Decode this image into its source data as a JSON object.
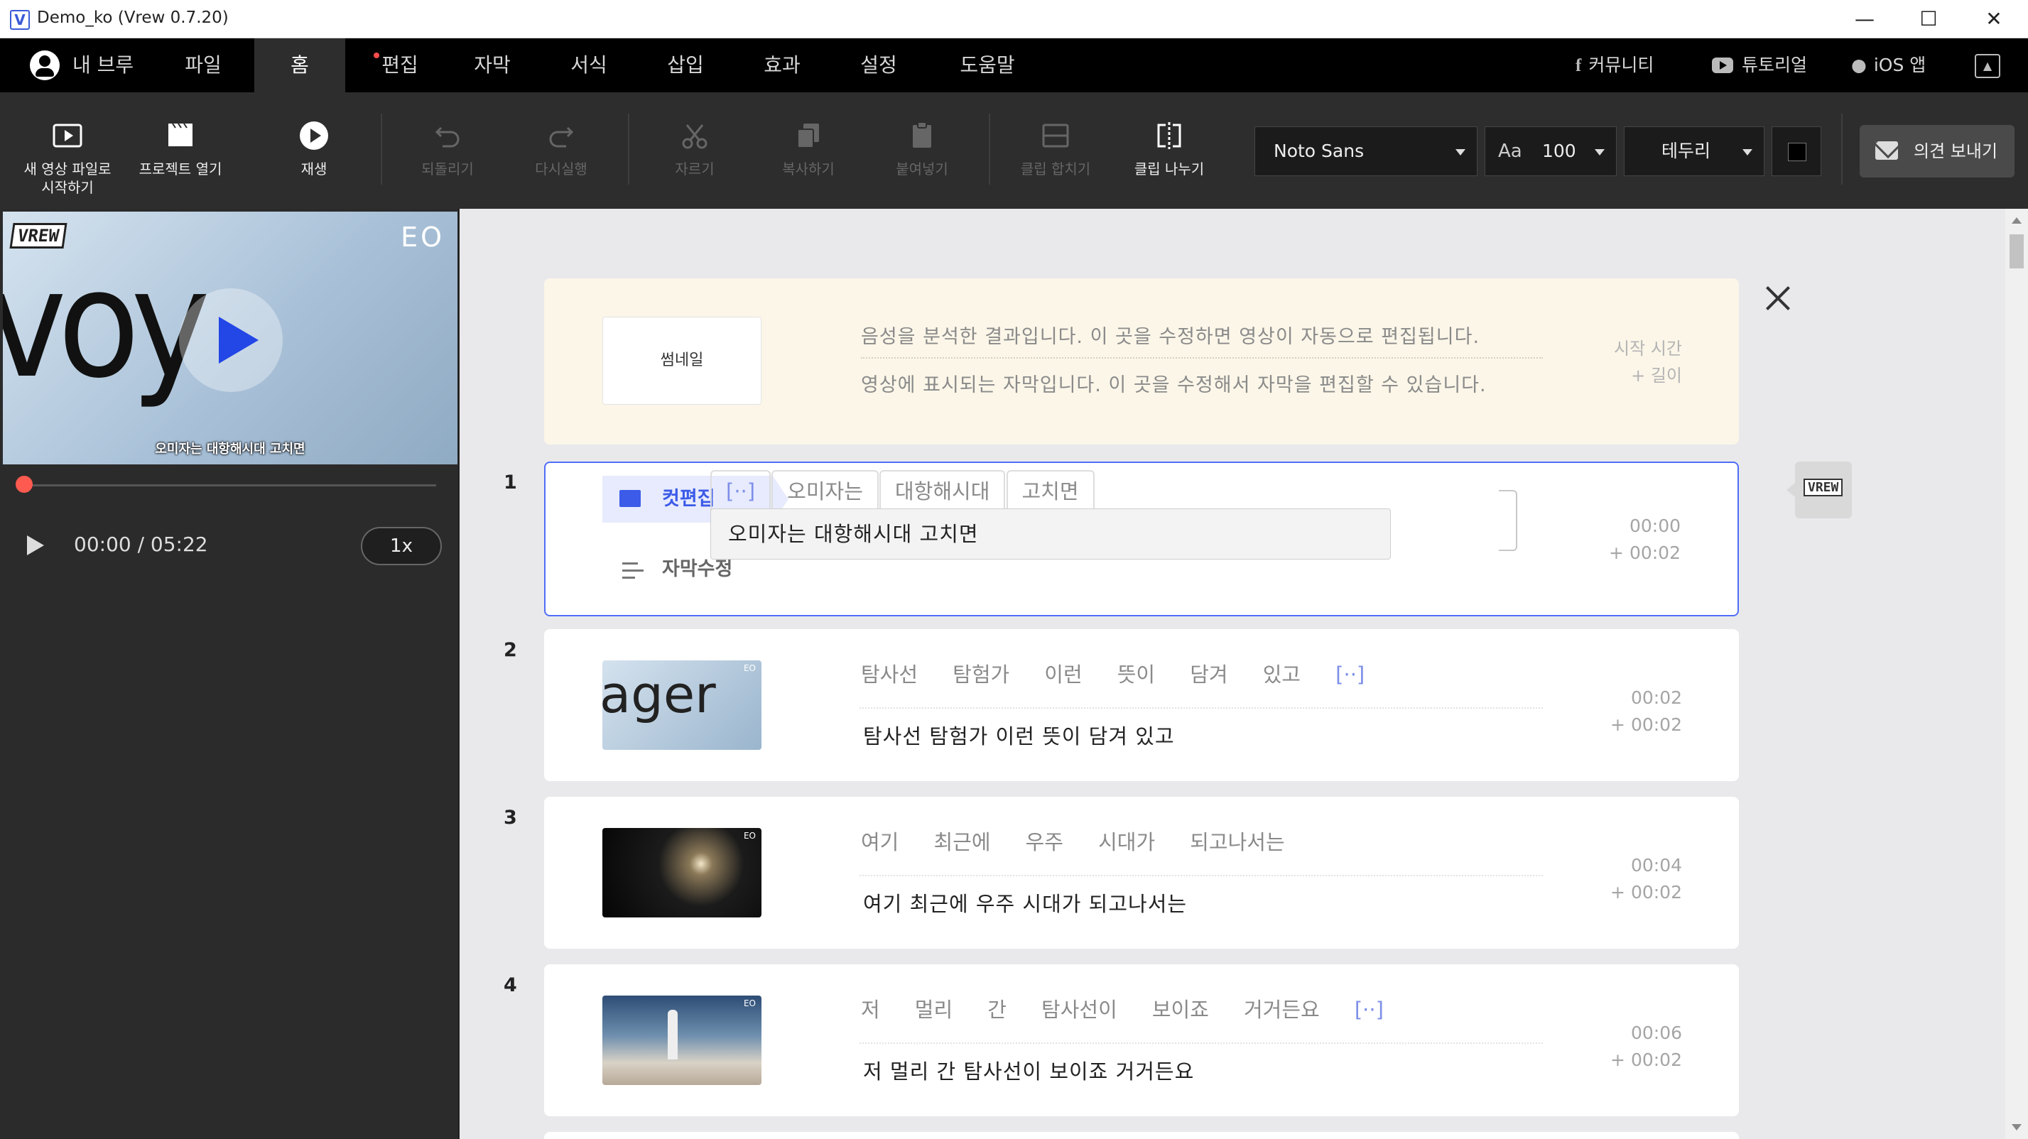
{
  "window": {
    "title": "Demo_ko (Vrew 0.7.20)",
    "app_icon": "V",
    "controls": {
      "minimize": "—",
      "maximize": "☐",
      "close": "✕"
    }
  },
  "menu": {
    "profile": "내 브루",
    "items": [
      "파일",
      "홈",
      "편집",
      "자막",
      "서식",
      "삽입",
      "효과",
      "설정",
      "도움말"
    ],
    "active": "홈",
    "right_links": {
      "community": "커뮤니티",
      "tutorial": "튜토리얼",
      "ios": "iOS 앱"
    },
    "collapse_icon": "▲"
  },
  "toolbar": {
    "new_video": "새 영상 파일로\n시작하기",
    "open_project": "프로젝트 열기",
    "play": "재생",
    "undo": "되돌리기",
    "redo": "다시실행",
    "cut": "자르기",
    "copy": "복사하기",
    "paste": "붙여넣기",
    "merge_clip": "클립 합치기",
    "split_clip": "클립 나누기",
    "font": "Noto Sans",
    "font_size": "100",
    "border_style": "테두리",
    "text_color": "#000000",
    "feedback": "의견 보내기"
  },
  "player": {
    "logo": "VREW",
    "channel": "EO",
    "frame_text": "voy",
    "subtitle": "오미자는 대항해시대 고치면",
    "progress": 0,
    "current_time": "00:00",
    "total_time": "05:22",
    "time_display": "00:00 / 05:22",
    "speed": "1x"
  },
  "guide": {
    "thumbnail_label": "썸네일",
    "line1": "음성을 분석한 결과입니다. 이 곳을 수정하면 영상이 자동으로 편집됩니다.",
    "line2": "영상에 표시되는 자막입니다. 이 곳을 수정해서 자막을 편집할 수 있습니다.",
    "start_label": "시작 시간",
    "length_label": "+ 길이"
  },
  "active_clip": {
    "cut_edit_label": "컷편집",
    "subtitle_edit_label": "자막수정"
  },
  "clips": [
    {
      "number": "1",
      "words": [
        "[··]",
        "오미자는",
        "대항해시대",
        "고치면"
      ],
      "subtitle": "오미자는 대항해시대 고치면",
      "start": "00:00",
      "length": "+ 00:02"
    },
    {
      "number": "2",
      "words": [
        "탐사선",
        "탐험가",
        "이런",
        "뜻이",
        "담겨",
        "있고",
        "[··]"
      ],
      "subtitle": "탐사선 탐험가 이런 뜻이 담겨 있고",
      "start": "00:02",
      "length": "+ 00:02",
      "thumb_text": "ager"
    },
    {
      "number": "3",
      "words": [
        "여기",
        "최근에",
        "우주",
        "시대가",
        "되고나서는"
      ],
      "subtitle": "여기 최근에 우주 시대가 되고나서는",
      "start": "00:04",
      "length": "+ 00:02"
    },
    {
      "number": "4",
      "words": [
        "저",
        "멀리",
        "간",
        "탐사선이",
        "보이죠",
        "거거든요",
        "[··]"
      ],
      "subtitle": "저 멀리 간 탐사선이 보이죠 거거든요",
      "start": "00:06",
      "length": "+ 00:02"
    }
  ],
  "side_logo": "VREW"
}
